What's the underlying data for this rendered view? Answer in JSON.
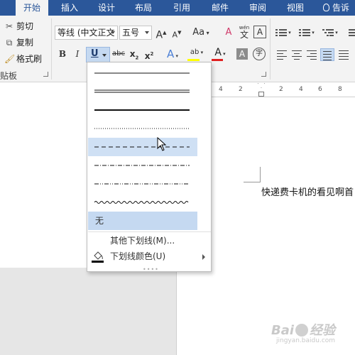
{
  "tabs": {
    "items": [
      "开始",
      "插入",
      "设计",
      "布局",
      "引用",
      "邮件",
      "审阅",
      "视图"
    ],
    "active": "开始",
    "search_text": "告诉"
  },
  "clipboard": {
    "cut": "剪切",
    "copy": "复制",
    "format_painter": "格式刷",
    "group_label": "贴板"
  },
  "font": {
    "font_name": "等线 (中文正文",
    "font_size": "五号",
    "grow": "A",
    "shrink": "A",
    "change_case": "Aa",
    "clear_format": "A",
    "phonetic_top": "wén",
    "phonetic": "文",
    "char_border": "A",
    "bold": "B",
    "italic": "I",
    "underline": "U",
    "strike": "abc",
    "subscript": "x",
    "superscript": "x",
    "subscript_mark": "2",
    "superscript_mark": "2",
    "text_effect": "A",
    "highlight": "ab",
    "font_color": "A",
    "char_shading": "A",
    "enclose": "字",
    "highlight_color": "#ffff00",
    "font_color_hex": "#e02020"
  },
  "ruler": {
    "ticks": [
      "4",
      "2",
      "2",
      "4",
      "6",
      "8"
    ]
  },
  "document": {
    "text": "快递费卡机的看见啊首"
  },
  "underline_menu": {
    "none_label": "无",
    "more_label": "其他下划线(M)...",
    "color_label": "下划线颜色(U)",
    "styles": [
      "single",
      "double",
      "thick",
      "dotted",
      "dashed",
      "dash-dot",
      "dash-dot-dot",
      "wave"
    ],
    "hovered": "dashed"
  },
  "watermark": {
    "text": "Bai",
    "text2": "经验",
    "url": "jingyan.baidu.com"
  }
}
